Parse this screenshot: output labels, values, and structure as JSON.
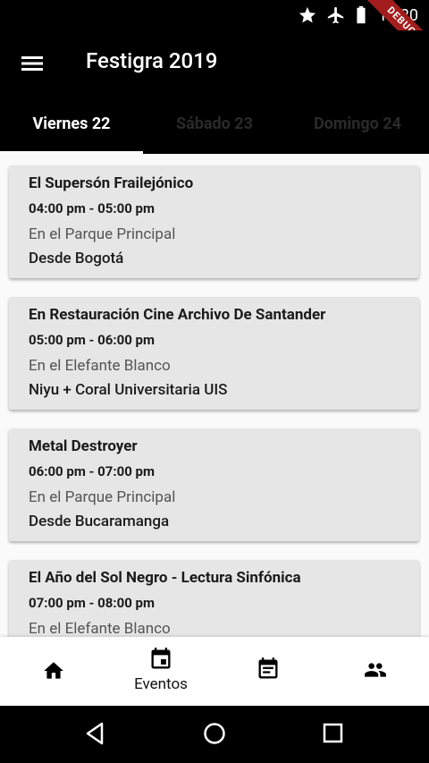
{
  "status": {
    "time": "10:20",
    "debug_label": "DEBUG"
  },
  "app": {
    "title": "Festigra 2019"
  },
  "tabs": [
    {
      "label": "Viernes 22"
    },
    {
      "label": "Sábado 23"
    },
    {
      "label": "Domingo 24"
    }
  ],
  "events": [
    {
      "title": "El Supersón Frailejónico",
      "time": "04:00 pm - 05:00 pm",
      "place": "En el Parque Principal",
      "subtitle": "Desde Bogotá"
    },
    {
      "title": "En Restauración Cine Archivo De Santander",
      "time": "05:00 pm - 06:00 pm",
      "place": "En el Elefante Blanco",
      "subtitle": "Niyu + Coral Universitaria UIS"
    },
    {
      "title": "Metal Destroyer",
      "time": "06:00 pm - 07:00 pm",
      "place": "En el Parque Principal",
      "subtitle": "Desde Bucaramanga"
    },
    {
      "title": "El Año del Sol Negro - Lectura Sinfónica",
      "time": "07:00 pm - 08:00 pm",
      "place": "En el Elefante Blanco",
      "subtitle": ""
    }
  ],
  "bottom_nav": {
    "events_label": "Eventos"
  },
  "colors": {
    "app_bar": "#000000",
    "card": "#e6e6e6",
    "debug_ribbon": "#a31d1d"
  }
}
